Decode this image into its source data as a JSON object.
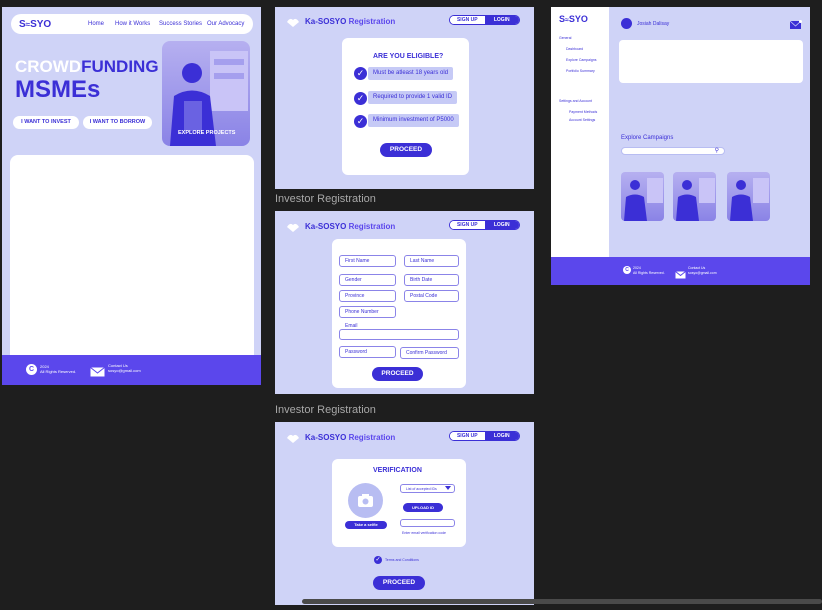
{
  "landing": {
    "logo": "S",
    "logo_rest": "SYO",
    "nav": [
      "Home",
      "How it Works",
      "Success Stories",
      "Our Advocacy"
    ],
    "hero_word1": "CROWD",
    "hero_word2": "FUNDING",
    "hero_word3": "MSMEs",
    "invest_btn": "I WANT TO INVEST",
    "borrow_btn": "I WANT TO BORROW",
    "explore_label": "EXPLORE PROJECTS",
    "footer_year": "2024",
    "footer_rights": "All Rights Reserved.",
    "footer_contact": "Contact Us",
    "footer_email": "sosyo@gmail.com"
  },
  "reg_header": {
    "brand_a": "Ka-SOSYO",
    "brand_b": "Registration",
    "signup": "SIGN UP",
    "login": "LOGIN"
  },
  "eligibility": {
    "title": "ARE YOU ELIGIBLE?",
    "items": [
      "Must be atleast 18 years old",
      "Required to provide 1 valid ID",
      "Minimum investment of P5000"
    ],
    "proceed": "PROCEED"
  },
  "labels": {
    "investor_reg_1": "Investor Registration",
    "investor_reg_2": "Investor Registration"
  },
  "form": {
    "first_name": "First Name",
    "last_name": "Last Name",
    "gender": "Gender",
    "birth_date": "Birth Date",
    "province": "Province",
    "postal": "Postal Code",
    "phone": "Phone Number",
    "email": "Email",
    "password": "Password",
    "confirm": "Confirm Password",
    "proceed": "PROCEED"
  },
  "verification": {
    "title": "VERIFICATION",
    "selfie_btn": "Take a selfie",
    "id_select": "List of accepted IDs",
    "upload": "UPLOAD ID",
    "email_hint": "Enter email verification code",
    "terms": "Terms and Conditions",
    "proceed": "PROCEED"
  },
  "dashboard": {
    "logo": "S",
    "logo_rest": "SYO",
    "user": "Josiah Dalisay",
    "general": "General",
    "nav1": "Dashboard",
    "nav2": "Explore Campaigns",
    "nav3": "Portfolio Summary",
    "settings": "Settings and Account",
    "nav4": "Payment Methods",
    "nav5": "Account Settings",
    "explore_title": "Explore Campaigns",
    "footer_year": "2024",
    "footer_rights": "All Rights Reserved.",
    "footer_contact": "Contact Us",
    "footer_email": "sosyo@gmail.com"
  }
}
